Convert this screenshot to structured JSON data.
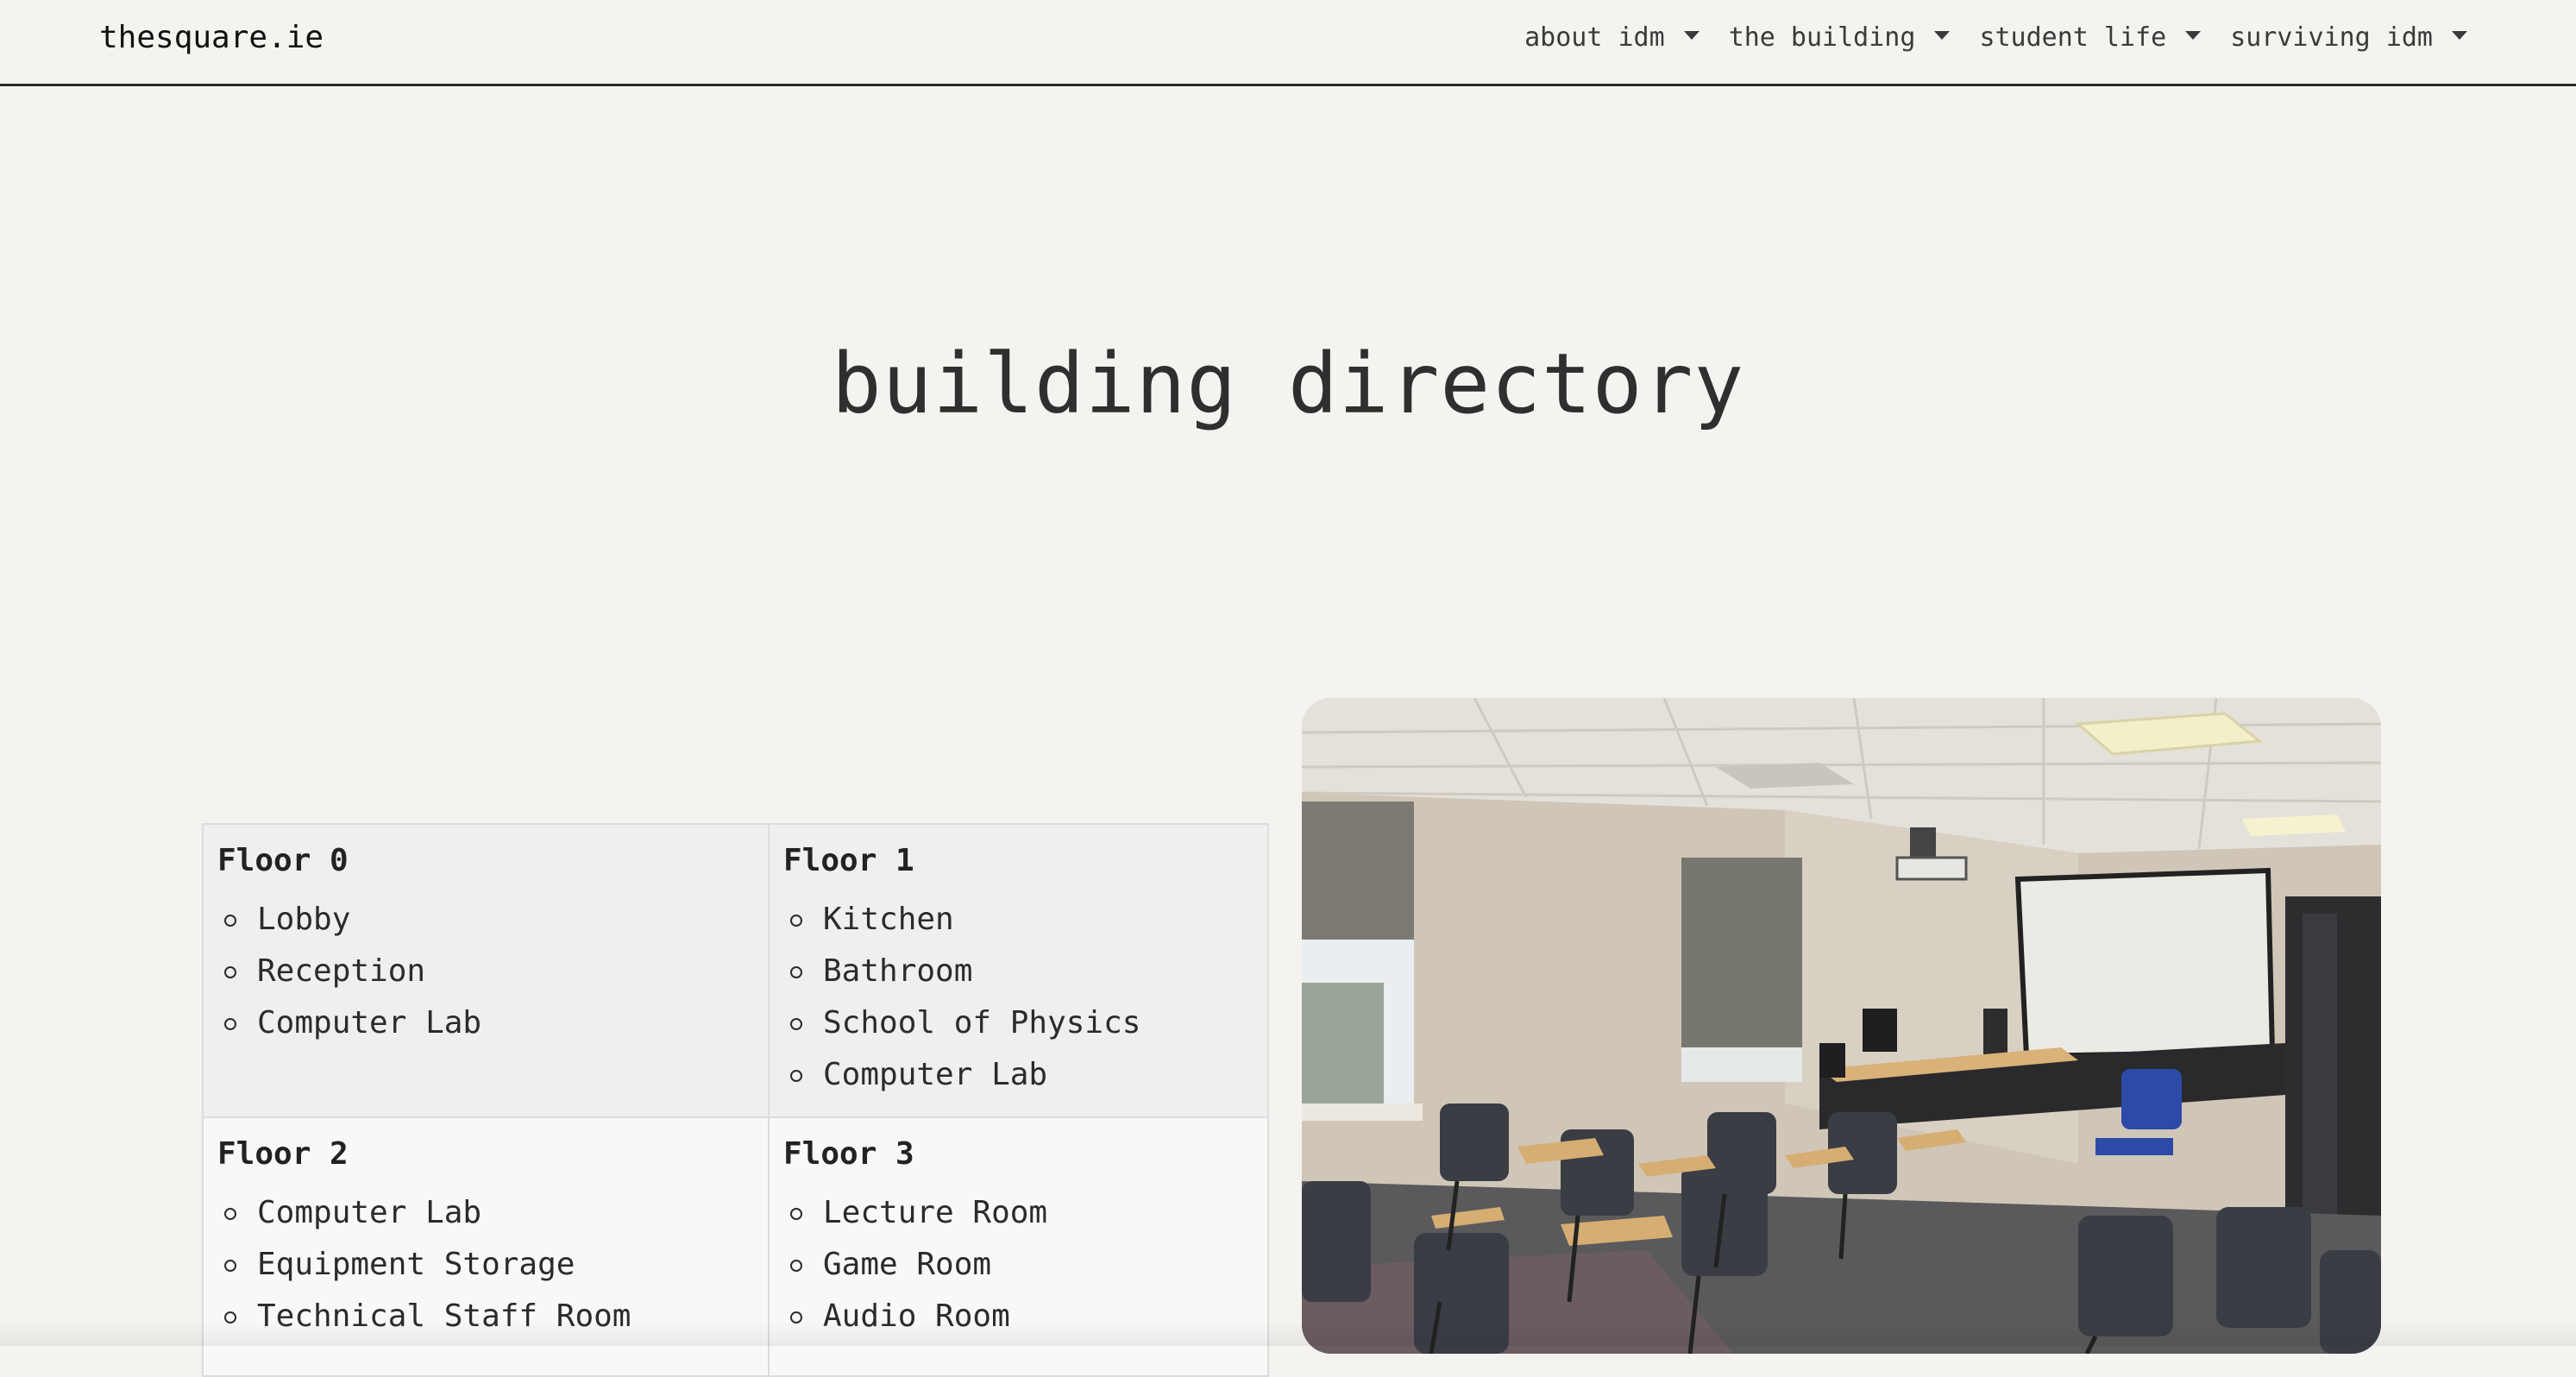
{
  "navbar": {
    "brand": "thesquare.ie",
    "items": [
      {
        "label": "about idm",
        "icon": "caret-down-icon"
      },
      {
        "label": "the building",
        "icon": "caret-down-icon"
      },
      {
        "label": "student life",
        "icon": "caret-down-icon"
      },
      {
        "label": "surviving idm",
        "icon": "caret-down-icon"
      }
    ]
  },
  "page": {
    "title": "building directory"
  },
  "directory": {
    "floors": [
      {
        "name": "Floor 0",
        "rooms": [
          "Lobby",
          "Reception",
          "Computer Lab"
        ]
      },
      {
        "name": "Floor 1",
        "rooms": [
          "Kitchen",
          "Bathroom",
          "School of Physics",
          "Computer Lab"
        ]
      },
      {
        "name": "Floor 2",
        "rooms": [
          "Computer Lab",
          "Equipment Storage",
          "Technical Staff Room"
        ]
      },
      {
        "name": "Floor 3",
        "rooms": [
          "Lecture Room",
          "Game Room",
          "Audio Room"
        ]
      }
    ]
  },
  "colors": {
    "background": "#f4f3ef",
    "text": "#2b2b2b",
    "nav_border": "#2b2b2b",
    "table_row_shaded": "#efefee",
    "table_row_light": "#f8f8f7",
    "table_border": "#dcdcdc"
  }
}
